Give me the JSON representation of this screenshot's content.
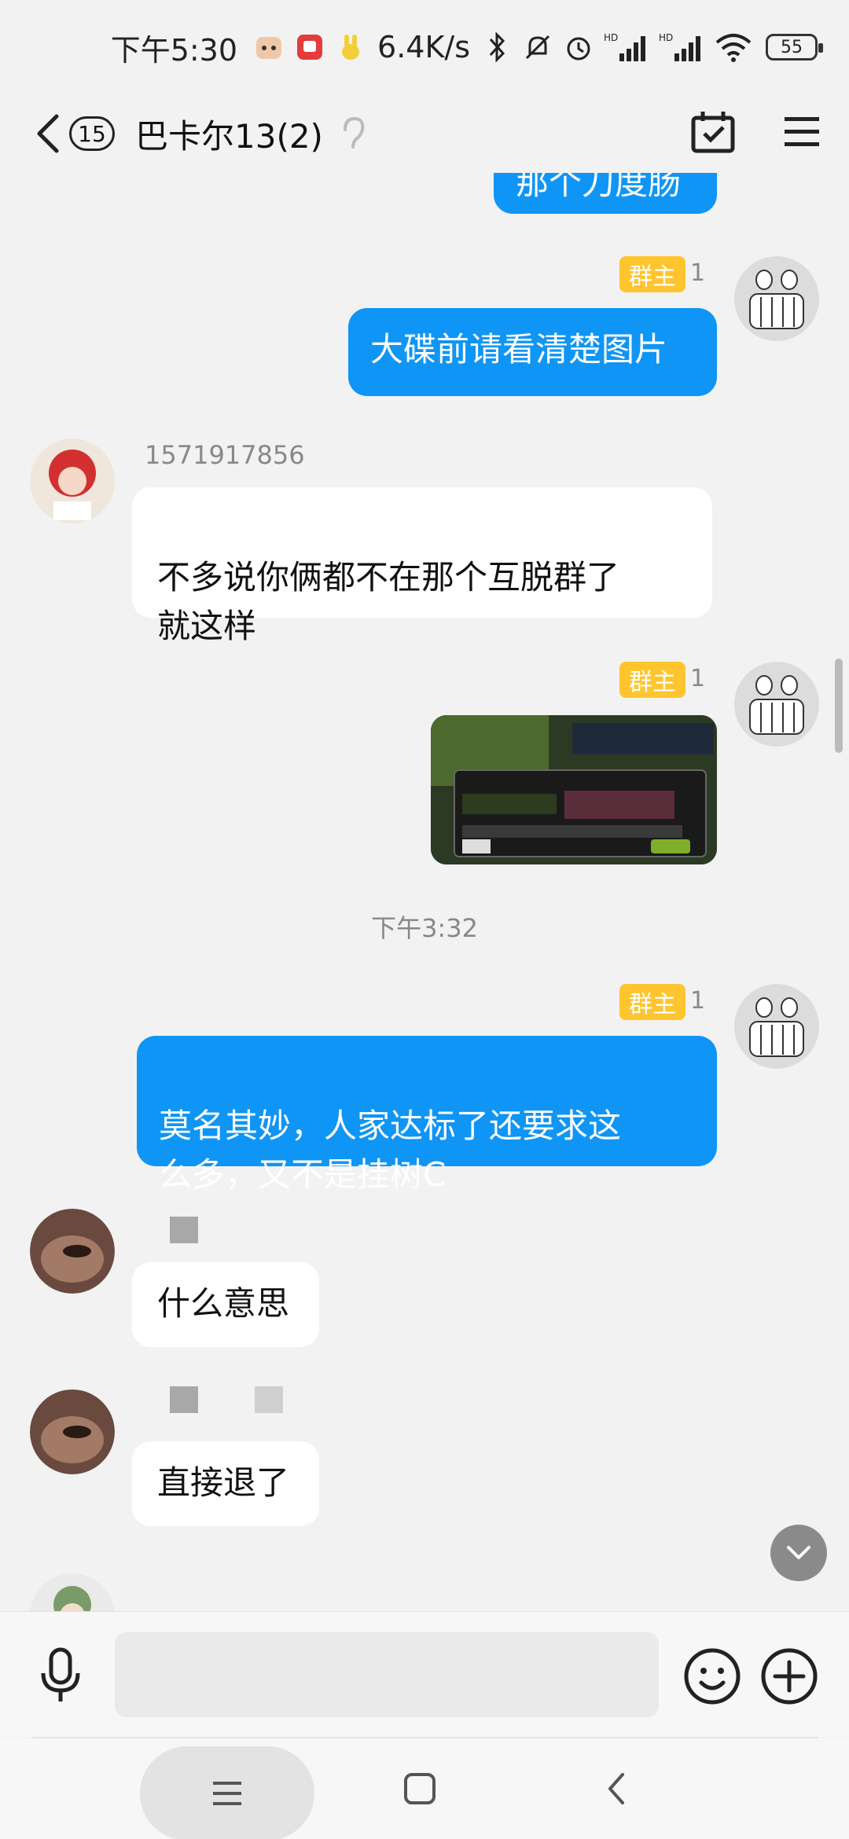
{
  "status": {
    "time": "下午5:30",
    "net_speed": "6.4K/s",
    "signal1_label": "HD",
    "signal2_label": "HD",
    "battery": "55"
  },
  "header": {
    "unread_count": "15",
    "title": "巴卡尔13(2)",
    "back_icon": "chevron-left-icon",
    "ear_icon": "ear-icon",
    "calendar_icon": "calendar-check-icon",
    "menu_icon": "menu-icon"
  },
  "messages": [
    {
      "from": "self",
      "text": "那个刀度肠",
      "partial": true
    },
    {
      "from": "self",
      "badge": "群主",
      "level": "1",
      "text": "大碟前请看清楚图片"
    },
    {
      "from": "other",
      "sender": "1571917856",
      "text": "不多说你俩都不在那个互脱群了\n就这样"
    },
    {
      "from": "self",
      "badge": "群主",
      "level": "1",
      "type": "image"
    },
    {
      "type": "timestamp",
      "text": "下午3:32"
    },
    {
      "from": "self",
      "badge": "群主",
      "level": "1",
      "text": "莫名其妙，人家达标了还要求这\n么多，又不是挂树C"
    },
    {
      "from": "other",
      "text": "什么意思"
    },
    {
      "from": "other",
      "text": "直接退了"
    }
  ],
  "input": {
    "placeholder": "",
    "mic_icon": "microphone-icon",
    "emoji_icon": "emoji-icon",
    "plus_icon": "plus-icon"
  },
  "colors": {
    "self_bubble": "#0f95f5",
    "owner_badge": "#ffc52e",
    "background": "#f2f2f2"
  }
}
